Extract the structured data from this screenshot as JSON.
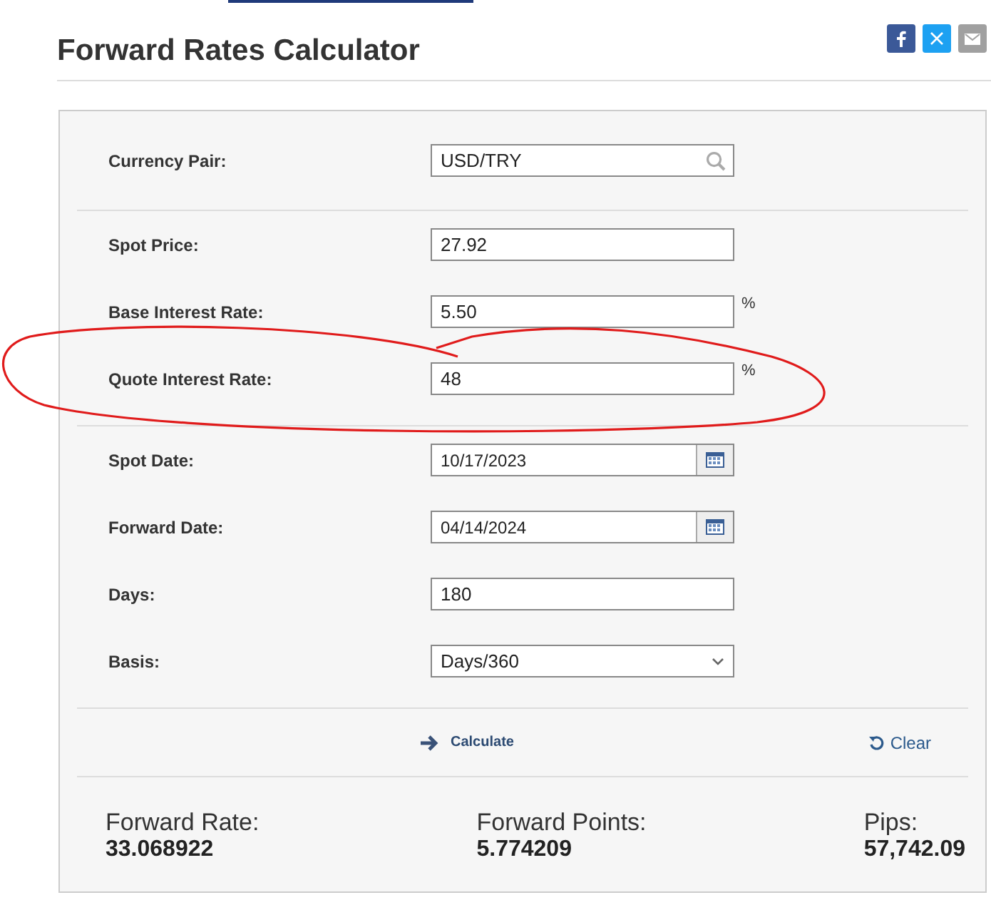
{
  "title": "Forward Rates Calculator",
  "share": [
    {
      "kind": "facebook",
      "color": "#3b5998"
    },
    {
      "kind": "x",
      "color": "#1da1f2"
    },
    {
      "kind": "email",
      "color": "#a0a0a0"
    }
  ],
  "sections": [
    {
      "rows": [
        {
          "label": "Currency Pair:",
          "kind": "search",
          "value": "USD/TRY",
          "circled": false
        }
      ]
    },
    {
      "rows": [
        {
          "label": "Spot Price:",
          "kind": "text",
          "value": "27.92",
          "circled": false
        },
        {
          "label": "Base Interest Rate:",
          "kind": "percent",
          "value": "5.50",
          "unit": "%",
          "circled": false
        },
        {
          "label": "Quote Interest Rate:",
          "kind": "percent",
          "value": "48",
          "unit": "%",
          "circled": true
        }
      ]
    },
    {
      "rows": [
        {
          "label": "Spot Date:",
          "kind": "date",
          "value": "10/17/2023",
          "circled": false
        },
        {
          "label": "Forward Date:",
          "kind": "date",
          "value": "04/14/2024",
          "circled": false
        },
        {
          "label": "Days:",
          "kind": "text",
          "value": "180",
          "circled": false
        },
        {
          "label": "Basis:",
          "kind": "select",
          "value": "Days/360",
          "circled": false
        }
      ]
    }
  ],
  "actions": {
    "calculate": "Calculate",
    "clear": "Clear"
  },
  "results": [
    {
      "label": "Forward Rate:",
      "value": "33.068922"
    },
    {
      "label": "Forward Points:",
      "value": "5.774209"
    },
    {
      "label": "Pips:",
      "value": "57,742.09"
    }
  ]
}
